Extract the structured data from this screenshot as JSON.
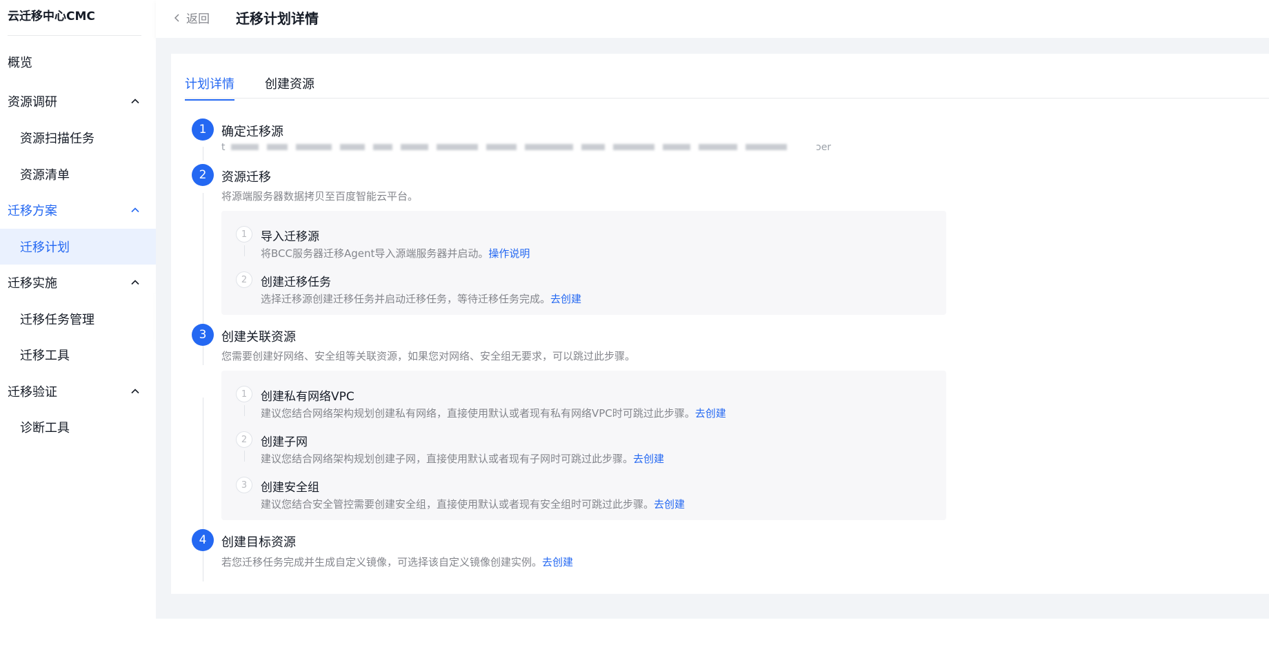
{
  "app": {
    "title": "云迁移中心CMC"
  },
  "sidebar": {
    "items": [
      {
        "label": "概览",
        "level": 1
      },
      {
        "label": "资源调研",
        "level": 1,
        "expanded": true
      },
      {
        "label": "资源扫描任务",
        "level": 2
      },
      {
        "label": "资源清单",
        "level": 2
      },
      {
        "label": "迁移方案",
        "level": 1,
        "expanded": true,
        "active": true
      },
      {
        "label": "迁移计划",
        "level": 2,
        "selected": true
      },
      {
        "label": "迁移实施",
        "level": 1,
        "expanded": true
      },
      {
        "label": "迁移任务管理",
        "level": 2
      },
      {
        "label": "迁移工具",
        "level": 2
      },
      {
        "label": "迁移验证",
        "level": 1,
        "expanded": true
      },
      {
        "label": "诊断工具",
        "level": 2
      }
    ]
  },
  "header": {
    "back_label": "返回",
    "title": "迁移计划详情"
  },
  "tabs": [
    {
      "label": "计划详情",
      "active": true
    },
    {
      "label": "创建资源",
      "active": false
    }
  ],
  "steps": [
    {
      "num": "1",
      "title": "确定迁移源",
      "desc_start": "t",
      "desc_end": "ɔer"
    },
    {
      "num": "2",
      "title": "资源迁移",
      "desc": "将源端服务器数据拷贝至百度智能云平台。",
      "substeps": [
        {
          "num": "1",
          "title": "导入迁移源",
          "desc": "将BCC服务器迁移Agent导入源端服务器并启动。",
          "link": "操作说明"
        },
        {
          "num": "2",
          "title": "创建迁移任务",
          "desc": "选择迁移源创建迁移任务并启动迁移任务，等待迁移任务完成。",
          "link": "去创建"
        }
      ]
    },
    {
      "num": "3",
      "title": "创建关联资源",
      "desc": "您需要创建好网络、安全组等关联资源，如果您对网络、安全组无要求，可以跳过此步骤。",
      "substeps": [
        {
          "num": "1",
          "title": "创建私有网络VPC",
          "desc": "建议您结合网络架构规划创建私有网络，直接使用默认或者现有私有网络VPC时可跳过此步骤。",
          "link": "去创建"
        },
        {
          "num": "2",
          "title": "创建子网",
          "desc": "建议您结合网络架构规划创建子网，直接使用默认或者现有子网时可跳过此步骤。",
          "link": "去创建"
        },
        {
          "num": "3",
          "title": "创建安全组",
          "desc": "建议您结合安全管控需要创建安全组，直接使用默认或者现有安全组时可跳过此步骤。",
          "link": "去创建"
        }
      ]
    },
    {
      "num": "4",
      "title": "创建目标资源",
      "desc": "若您迁移任务完成并生成自定义镜像，可选择该自定义镜像创建实例。",
      "link": "去创建"
    }
  ],
  "colors": {
    "accent": "#2468f2",
    "text": "#151b26",
    "muted": "#84868c",
    "panel": "#f7f7f9",
    "page_bg": "#f2f4f7"
  },
  "icons": {
    "back": "chevron-left-icon",
    "group_toggle": "chevron-up-icon",
    "collapse": "caret-left-icon"
  }
}
